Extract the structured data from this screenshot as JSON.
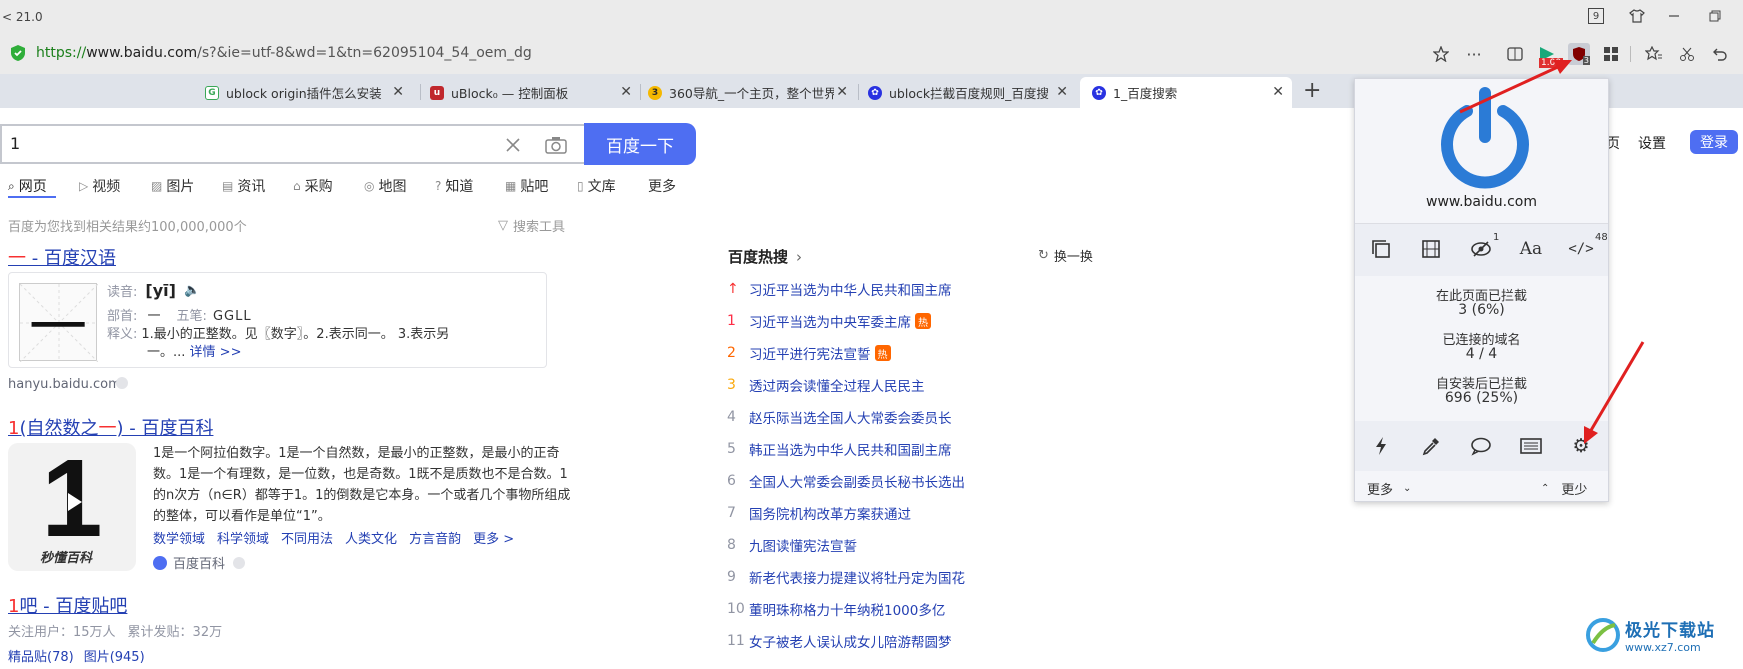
{
  "window": {
    "title": "< 21.0",
    "badge": "9"
  },
  "address": {
    "scheme": "https://",
    "domain": "www.baidu.com",
    "path": "/s?&ie=utf-8&wd=1&tn=62095104_54_oem_dg",
    "ext_badge_1": "1.00",
    "ext_badge_2": "3"
  },
  "tabs": [
    {
      "label": "ublock origin插件怎么安装",
      "color": "#3aa757"
    },
    {
      "label": "uBlock₀ — 控制面板",
      "color": "#c0272d"
    },
    {
      "label": "360导航_一个主页，整个世界",
      "color": "#f5b800"
    },
    {
      "label": "ublock拦截百度规则_百度搜",
      "color": "#2932e1"
    },
    {
      "label": "1_百度搜索",
      "color": "#2932e1"
    }
  ],
  "new_tab": "+",
  "search": {
    "query": "1",
    "button": "百度一下"
  },
  "topnav": {
    "settings": "设置",
    "login": "登录",
    "home_fragment": "页"
  },
  "nav_tabs": [
    "网页",
    "视频",
    "图片",
    "资讯",
    "采购",
    "地图",
    "知道",
    "贴吧",
    "文库",
    "更多"
  ],
  "result_count": "百度为您找到相关结果约100,000,000个",
  "search_tools": "搜索工具",
  "result1": {
    "title_hl": "一",
    "title_rest": " - 百度汉语",
    "glyph": "一",
    "pinyin_label": "读音:",
    "pinyin": "[yī]",
    "radical_label": "部首:",
    "radical": "一",
    "wubi_label": "五笔:",
    "wubi": "GGLL",
    "def_label": "释义:",
    "def_line1": "1.最小的正整数。见〖数字〗。2.表示同一。 3.表示另",
    "def_line2": "一。...",
    "more": "详情 >>",
    "source": "hanyu.baidu.com"
  },
  "result2": {
    "title_hl": "1",
    "title_mid": "(自然数之",
    "title_hl2": "一",
    "title_rest": ") - 百度百科",
    "line1": "1是一个阿拉伯数字。1是一个自然数，是最小的正整数，是最小的正奇",
    "line2": "数。1是一个有理数，是一位数，也是奇数。1既不是质数也不是合数。1",
    "line3": "的n次方（n∈R）都等于1。1的倒数是它本身。一个或者几个事物所组成",
    "line4": "的整体，可以看作是单位“1”。",
    "links": [
      "数学领域",
      "科学领域",
      "不同用法",
      "人类文化",
      "方言音韵",
      "更多 >"
    ],
    "source": "百度百科",
    "thumb_text": "1",
    "thumb_caption": "秒懂百科"
  },
  "result3": {
    "title_hl": "1",
    "title_rest": "吧 - 百度贴吧",
    "follow": "关注用户：15万人",
    "posts": "累计发贴：32万",
    "links": [
      "精品贴(78)",
      "图片(945)"
    ]
  },
  "hot": {
    "title": "百度热搜",
    "refresh": "换一换",
    "items": [
      {
        "rank": "↑",
        "text": "习近平当选为中华人民共和国主席",
        "hot": false
      },
      {
        "rank": "1",
        "text": "习近平当选为中央军委主席",
        "hot": true
      },
      {
        "rank": "2",
        "text": "习近平进行宪法宣誓",
        "hot": true
      },
      {
        "rank": "3",
        "text": "透过两会读懂全过程人民民主",
        "hot": false
      },
      {
        "rank": "4",
        "text": "赵乐际当选全国人大常委会委员长",
        "hot": false
      },
      {
        "rank": "5",
        "text": "韩正当选为中华人民共和国副主席",
        "hot": false
      },
      {
        "rank": "6",
        "text": "全国人大常委会副委员长秘书长选出",
        "hot": false
      },
      {
        "rank": "7",
        "text": "国务院机构改革方案获通过",
        "hot": false
      },
      {
        "rank": "8",
        "text": "九图读懂宪法宣誓",
        "hot": false
      },
      {
        "rank": "9",
        "text": "新老代表接力提建议将牡丹定为国花",
        "hot": false
      },
      {
        "rank": "10",
        "text": "董明珠称格力十年纳税1000多亿",
        "hot": false
      },
      {
        "rank": "11",
        "text": "女子被老人误认成女儿陪游帮圆梦",
        "hot": false
      }
    ],
    "hot_badge": "热"
  },
  "popup": {
    "domain": "www.baidu.com",
    "icon_badge_1": "1",
    "icon_badge_2": "48",
    "font_icon": "Aa",
    "blocked_page_label": "在此页面已拦截",
    "blocked_page": "3 (6%)",
    "domains_label": "已连接的域名",
    "domains": "4 / 4",
    "since_install_label": "自安装后已拦截",
    "since_install": "696 (25%)",
    "more": "更多",
    "less": "更少"
  },
  "watermark": {
    "text": "极光下载站",
    "url": "www.xz7.com"
  },
  "colors": {
    "baidu_blue": "#4e6ef2",
    "link": "#2440b3",
    "highlight": "#f73131",
    "power": "#2b7bd6",
    "arrow": "#e02020"
  }
}
